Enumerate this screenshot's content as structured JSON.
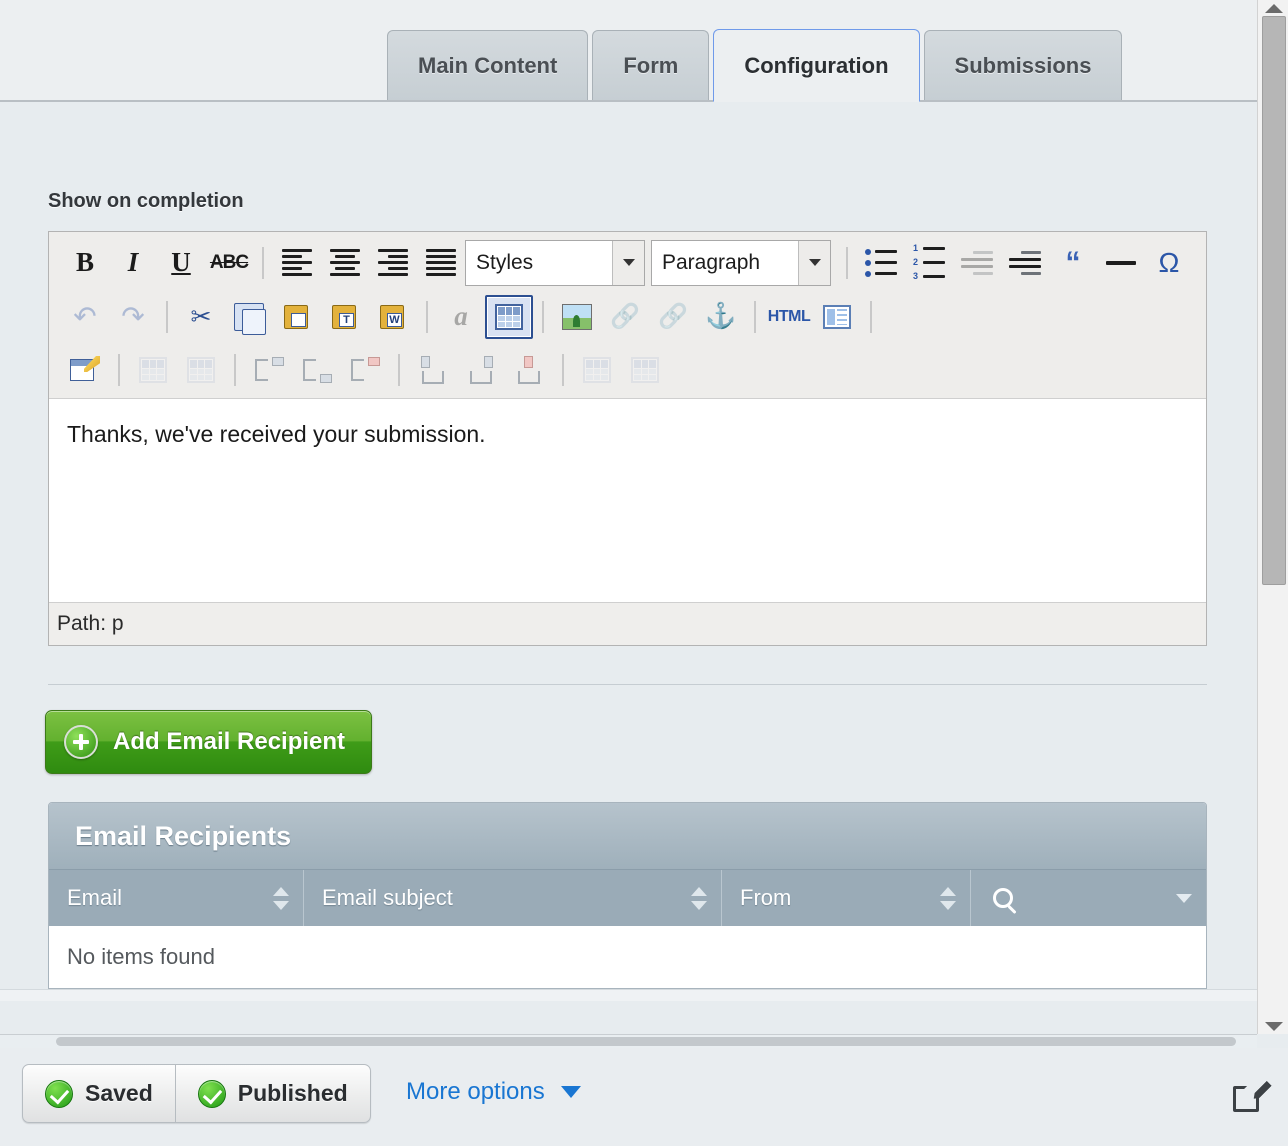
{
  "tabs": [
    {
      "label": "Main Content",
      "active": false
    },
    {
      "label": "Form",
      "active": false
    },
    {
      "label": "Configuration",
      "active": true
    },
    {
      "label": "Submissions",
      "active": false
    }
  ],
  "field": {
    "label": "Show on completion"
  },
  "editor": {
    "styles_select": "Styles",
    "format_select": "Paragraph",
    "body_text": "Thanks, we've received your submission.",
    "status_path": "Path: p",
    "toolbar_row1": [
      {
        "name": "bold-icon",
        "title": "Bold",
        "glyph": "B"
      },
      {
        "name": "italic-icon",
        "title": "Italic",
        "glyph": "I"
      },
      {
        "name": "underline-icon",
        "title": "Underline",
        "glyph": "U"
      },
      {
        "name": "strikethrough-icon",
        "title": "Strike Through",
        "glyph": "ABC"
      },
      {
        "name": "align-left-icon",
        "title": "Align Left"
      },
      {
        "name": "align-center-icon",
        "title": "Center"
      },
      {
        "name": "align-right-icon",
        "title": "Align Right"
      },
      {
        "name": "justify-icon",
        "title": "Justify"
      },
      {
        "name": "bullet-list-icon",
        "title": "Insert/Remove Bulleted List"
      },
      {
        "name": "numbered-list-icon",
        "title": "Insert/Remove Numbered List"
      },
      {
        "name": "outdent-icon",
        "title": "Decrease Indent"
      },
      {
        "name": "indent-icon",
        "title": "Increase Indent"
      },
      {
        "name": "blockquote-icon",
        "title": "Block Quote"
      },
      {
        "name": "horizontal-rule-icon",
        "title": "Insert Horizontal Line"
      },
      {
        "name": "special-character-icon",
        "title": "Insert Special Character"
      }
    ],
    "toolbar_row2": [
      {
        "name": "undo-icon",
        "title": "Undo"
      },
      {
        "name": "redo-icon",
        "title": "Redo"
      },
      {
        "name": "cut-icon",
        "title": "Cut"
      },
      {
        "name": "copy-icon",
        "title": "Copy"
      },
      {
        "name": "paste-icon",
        "title": "Paste"
      },
      {
        "name": "paste-as-text-icon",
        "title": "Paste as plain text"
      },
      {
        "name": "paste-from-word-icon",
        "title": "Paste from Word"
      },
      {
        "name": "show-blocks-icon",
        "title": "Show Blocks"
      },
      {
        "name": "insert-table-icon",
        "title": "Table"
      },
      {
        "name": "insert-image-icon",
        "title": "Image"
      },
      {
        "name": "insert-link-icon",
        "title": "Link"
      },
      {
        "name": "unlink-icon",
        "title": "Unlink"
      },
      {
        "name": "anchor-icon",
        "title": "Anchor"
      },
      {
        "name": "html-source-icon",
        "title": "HTML"
      },
      {
        "name": "templates-icon",
        "title": "Templates"
      }
    ],
    "toolbar_row3": [
      {
        "name": "table-properties-icon",
        "title": "Table Properties"
      },
      {
        "name": "merge-cells-icon",
        "title": "Merge Cells"
      },
      {
        "name": "split-cell-icon",
        "title": "Split Cell"
      },
      {
        "name": "insert-row-before-icon",
        "title": "Insert Row Before"
      },
      {
        "name": "insert-row-after-icon",
        "title": "Insert Row After"
      },
      {
        "name": "delete-row-icon",
        "title": "Delete Row"
      },
      {
        "name": "insert-column-before-icon",
        "title": "Insert Column Before"
      },
      {
        "name": "insert-column-after-icon",
        "title": "Insert Column After"
      },
      {
        "name": "delete-column-icon",
        "title": "Delete Column"
      },
      {
        "name": "table-cell-properties-icon",
        "title": "Cell Properties"
      },
      {
        "name": "table-row-properties-icon",
        "title": "Row Properties"
      }
    ]
  },
  "add_button": {
    "label": "Add Email Recipient"
  },
  "panel": {
    "title": "Email Recipients",
    "columns": [
      {
        "label": "Email",
        "sortable": true
      },
      {
        "label": "Email subject",
        "sortable": true
      },
      {
        "label": "From",
        "sortable": true
      }
    ],
    "search_label": "",
    "empty_text": "No items found",
    "rows": []
  },
  "bottom_bar": {
    "saved_label": "Saved",
    "published_label": "Published",
    "more_options_label": "More options"
  },
  "colors": {
    "accent_blue": "#1976d2",
    "tab_active_border": "#6f9aea",
    "add_button_green": "#3f9c18",
    "panel_header": "#9fb0bb",
    "table_header": "#9aabb7"
  }
}
